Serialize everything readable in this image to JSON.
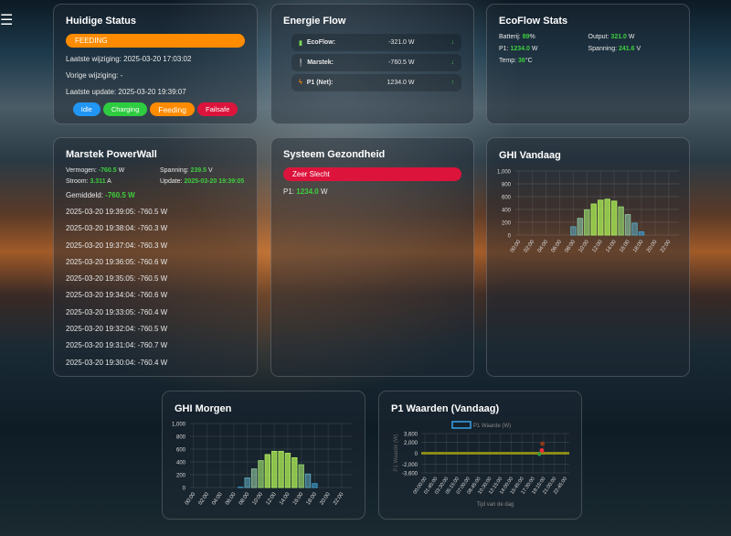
{
  "menu_icon": "hamburger-icon",
  "status": {
    "title": "Huidige Status",
    "state": "FEEDING",
    "last_change": "Laatste wijziging: 2025-03-20 17:03:02",
    "prev_change": "Vorige wijziging: -",
    "last_update": "Laatste update: 2025-03-20 19:39:07",
    "chips": [
      {
        "label": "Idle",
        "color": "#2196f3"
      },
      {
        "label": "Charging",
        "color": "#2ecc40"
      },
      {
        "label": "Feeding",
        "color": "#ff8c00"
      },
      {
        "label": "Failsafe",
        "color": "#dc143c"
      }
    ],
    "state_color": "#ff8c00"
  },
  "flow": {
    "title": "Energie Flow",
    "items": [
      {
        "label": "EcoFlow:",
        "value": "-321.0 W",
        "arrow": "↓",
        "icon": "battery-icon"
      },
      {
        "label": "Marstek:",
        "value": "-760.5 W",
        "arrow": "↓",
        "icon": "plug-icon"
      },
      {
        "label": "P1 (Net):",
        "value": "1234.0 W",
        "arrow": "↑",
        "icon": "bolt-icon"
      }
    ]
  },
  "ecoflow": {
    "title": "EcoFlow Stats",
    "battery_label": "Batterij:",
    "battery": "89",
    "battery_unit": "%",
    "output_label": "Output:",
    "output": "321.0",
    "output_unit": "W",
    "p1_label": "P1:",
    "p1": "1234.0",
    "p1_unit": "W",
    "voltage_label": "Spanning:",
    "voltage": "241.6",
    "voltage_unit": "V",
    "temp_label": "Temp:",
    "temp": "36",
    "temp_unit": "°C"
  },
  "marstek": {
    "title": "Marstek PowerWall",
    "power_label": "Vermogen:",
    "power": "-760.5",
    "power_unit": "W",
    "voltage_label": "Spanning:",
    "voltage": "239.5",
    "voltage_unit": "V",
    "current_label": "Stroom:",
    "current": "3.311",
    "current_unit": "A",
    "update_label": "Update:",
    "update": "2025-03-20 19:39:05",
    "avg_label": "Gemiddeld:",
    "avg": "-760.5 W",
    "history": [
      "2025-03-20 19:39:05: -760.5 W",
      "2025-03-20 19:38:04: -760.3 W",
      "2025-03-20 19:37:04: -760.3 W",
      "2025-03-20 19:36:05: -760.6 W",
      "2025-03-20 19:35:05: -760.5 W",
      "2025-03-20 19:34:04: -760.6 W",
      "2025-03-20 19:33:05: -760.4 W",
      "2025-03-20 19:32:04: -760.5 W",
      "2025-03-20 19:31:04: -760.7 W",
      "2025-03-20 19:30:04: -760.4 W"
    ]
  },
  "health": {
    "title": "Systeem Gezondheid",
    "state": "Zeer Slecht",
    "state_color": "#dc143c",
    "p1_label": "P1:",
    "p1": "1234.0",
    "p1_unit": "W"
  },
  "chart_data": [
    {
      "type": "bar",
      "title": "GHI Vandaag",
      "categories": [
        "00:00",
        "01:00",
        "02:00",
        "03:00",
        "04:00",
        "05:00",
        "06:00",
        "07:00",
        "08:00",
        "09:00",
        "10:00",
        "11:00",
        "12:00",
        "13:00",
        "14:00",
        "15:00",
        "16:00",
        "17:00",
        "18:00",
        "19:00",
        "20:00",
        "21:00",
        "22:00",
        "23:00"
      ],
      "values": [
        0,
        0,
        0,
        0,
        0,
        0,
        0,
        0,
        130,
        260,
        395,
        485,
        545,
        560,
        530,
        440,
        320,
        185,
        50,
        0,
        0,
        0,
        0,
        0
      ],
      "ylim": [
        0,
        1000
      ],
      "yticks": [
        "1,000",
        "800",
        "600",
        "400",
        "200",
        "0"
      ],
      "xticks": [
        "00:00",
        "02:00",
        "04:00",
        "06:00",
        "08:00",
        "10:00",
        "12:00",
        "14:00",
        "16:00",
        "18:00",
        "20:00",
        "22:00"
      ]
    },
    {
      "type": "bar",
      "title": "GHI Morgen",
      "categories": [
        "00:00",
        "01:00",
        "02:00",
        "03:00",
        "04:00",
        "05:00",
        "06:00",
        "07:00",
        "08:00",
        "09:00",
        "10:00",
        "11:00",
        "12:00",
        "13:00",
        "14:00",
        "15:00",
        "16:00",
        "17:00",
        "18:00",
        "19:00",
        "20:00",
        "21:00",
        "22:00",
        "23:00"
      ],
      "values": [
        0,
        0,
        0,
        0,
        0,
        0,
        0,
        5,
        150,
        290,
        420,
        515,
        565,
        565,
        535,
        465,
        355,
        210,
        60,
        0,
        0,
        0,
        0,
        0
      ],
      "ylim": [
        0,
        1000
      ],
      "yticks": [
        "1,000",
        "800",
        "600",
        "400",
        "200",
        "0"
      ],
      "xticks": [
        "00:00",
        "02:00",
        "04:00",
        "06:00",
        "08:00",
        "10:00",
        "12:00",
        "14:00",
        "16:00",
        "18:00",
        "20:00",
        "22:00"
      ]
    },
    {
      "type": "line",
      "title": "P1 Waarden (Vandaag)",
      "legend": "P1 Waarde (W)",
      "xlabel": "Tijd van de dag",
      "ylabel": "P1 Waarde (W)",
      "ylim": [
        -3600,
        3600
      ],
      "yticks": [
        "3,600",
        "2,000",
        "0",
        "-2,000",
        "-3,600"
      ],
      "xticks": [
        "00:00:00",
        "01:45:00",
        "03:30:00",
        "05:15:00",
        "07:00:00",
        "08:45:00",
        "10:30:00",
        "12:15:00",
        "14:00:00",
        "15:45:00",
        "17:30:00",
        "19:15:00",
        "21:00:00",
        "22:45:00"
      ],
      "points": [
        {
          "h": 0,
          "v": 0
        },
        {
          "h": 18.8,
          "v": 0
        },
        {
          "h": 18.9,
          "v": -250
        },
        {
          "h": 19.4,
          "v": -250
        },
        {
          "h": 19.55,
          "v": 500
        },
        {
          "h": 19.65,
          "v": 1234
        },
        {
          "h": 24,
          "v": 0
        }
      ]
    }
  ]
}
